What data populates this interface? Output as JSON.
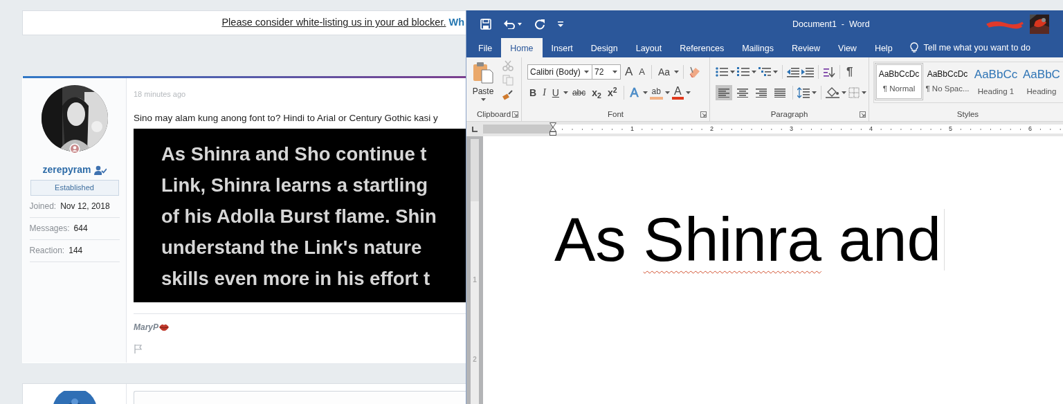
{
  "forum": {
    "notice": {
      "text": "Please consider white-listing us in your ad blocker.",
      "link": "Wh"
    },
    "post": {
      "username": "zerepyram",
      "user_title": "Established",
      "stats": [
        {
          "label": "Joined:",
          "value": "Nov 12, 2018"
        },
        {
          "label": "Messages:",
          "value": "644"
        },
        {
          "label": "Reaction:",
          "value": "144"
        }
      ],
      "time": "18 minutes ago",
      "message": "Sino may alam kung anong font to? Hindi to Arial or Century Gothic kasi y",
      "image_lines": [
        "As Shinra and Sho continue t",
        "Link, Shinra learns a startling",
        "of his Adolla Burst flame. Shin",
        "understand the Link's nature",
        "skills even more in his effort t"
      ],
      "signature": "MaryP"
    }
  },
  "word": {
    "title": "Document1  -  Word",
    "tabs": [
      {
        "label": "File",
        "selected": false
      },
      {
        "label": "Home",
        "selected": true
      },
      {
        "label": "Insert",
        "selected": false
      },
      {
        "label": "Design",
        "selected": false
      },
      {
        "label": "Layout",
        "selected": false
      },
      {
        "label": "References",
        "selected": false
      },
      {
        "label": "Mailings",
        "selected": false
      },
      {
        "label": "Review",
        "selected": false
      },
      {
        "label": "View",
        "selected": false
      },
      {
        "label": "Help",
        "selected": false
      }
    ],
    "tell_me": "Tell me what you want to do",
    "paste": "Paste",
    "clipboard_tools": [
      {
        "kind": "cut",
        "disabled": true
      },
      {
        "kind": "copy",
        "disabled": true
      },
      {
        "kind": "painter",
        "disabled": false
      }
    ],
    "font_name": "Calibri (Body)",
    "font_size": "72",
    "font_row1": [
      {
        "kind": "grow",
        "label": "A",
        "dropdown": false
      },
      {
        "kind": "shrink",
        "label": "A",
        "dropdown": false
      },
      {
        "kind": "case",
        "label": "Aa",
        "dropdown": true
      }
    ],
    "font_row2": [
      {
        "kind": "bold",
        "label": "B",
        "dropdown": false
      },
      {
        "kind": "italic",
        "label": "I",
        "dropdown": false
      },
      {
        "kind": "underline",
        "label": "U",
        "dropdown": true
      },
      {
        "kind": "strike",
        "label": "abc",
        "dropdown": false
      },
      {
        "kind": "sub",
        "label": "x$_{2}$",
        "dropdown": false
      },
      {
        "kind": "sup",
        "label": "x$^{2}$",
        "dropdown": false
      },
      {
        "kind": "effects",
        "label": "A",
        "dropdown": true
      },
      {
        "kind": "highlight",
        "label": "ab",
        "dropdown": true
      },
      {
        "kind": "color",
        "label": "A",
        "dropdown": true
      }
    ],
    "show_marks": "¶",
    "alignment_buttons": [
      {
        "kind": "left",
        "selected": true
      },
      {
        "kind": "center",
        "selected": false
      },
      {
        "kind": "right",
        "selected": false
      },
      {
        "kind": "justify",
        "selected": false
      }
    ],
    "groups": [
      {
        "label": "Clipboard",
        "launcher": true
      },
      {
        "label": "Font",
        "launcher": true
      },
      {
        "label": "Paragraph",
        "launcher": true
      },
      {
        "label": "Styles",
        "launcher": false
      }
    ],
    "styles": [
      {
        "preview": "AaBbCcDc",
        "name": "¶ Normal",
        "kind": "body",
        "selected": true
      },
      {
        "preview": "AaBbCcDc",
        "name": "¶ No Spac...",
        "kind": "body",
        "selected": false
      },
      {
        "preview": "AaBbCc",
        "name": "Heading 1",
        "kind": "heading",
        "selected": false
      },
      {
        "preview": "AaBbC",
        "name": "Heading",
        "kind": "heading",
        "selected": false
      }
    ],
    "ruler_numbers": [
      "1",
      "2",
      "3",
      "4",
      "5",
      "6"
    ],
    "vertical_ruler_numbers": [
      "1",
      "2"
    ],
    "document_words": [
      {
        "text": "As",
        "misspelled": false
      },
      {
        "text": "Shinra",
        "misspelled": true
      },
      {
        "text": "and",
        "misspelled": false
      }
    ]
  }
}
